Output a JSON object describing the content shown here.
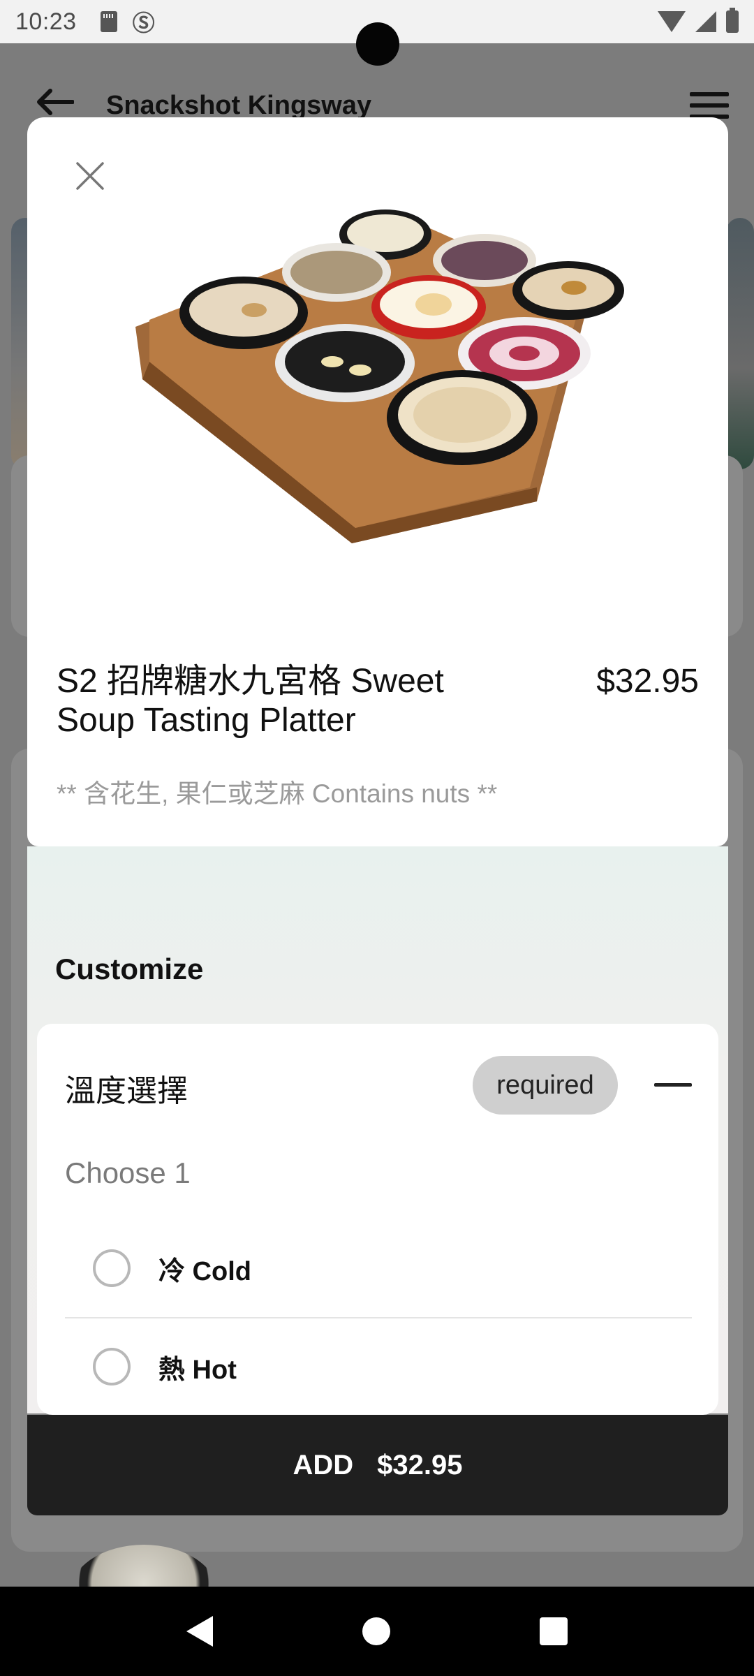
{
  "status_bar": {
    "time": "10:23"
  },
  "background": {
    "store_title": "Snackshot Kingsway"
  },
  "item": {
    "title": "S2 招牌糖水九宮格 Sweet Soup Tasting Platter",
    "price": "$32.95",
    "description": "** 含花生, 果仁或芝麻 Contains nuts **"
  },
  "customize": {
    "heading": "Customize",
    "group": {
      "title": "溫度選擇",
      "badge": "required",
      "hint": "Choose 1",
      "options": [
        {
          "label": "冷 Cold"
        },
        {
          "label": "熱 Hot"
        }
      ]
    }
  },
  "add_button": {
    "label": "ADD",
    "price": "$32.95"
  },
  "icons": {
    "close": "close-icon",
    "back": "arrow-left-icon",
    "menu": "hamburger-menu-icon",
    "collapse": "minus-icon"
  }
}
